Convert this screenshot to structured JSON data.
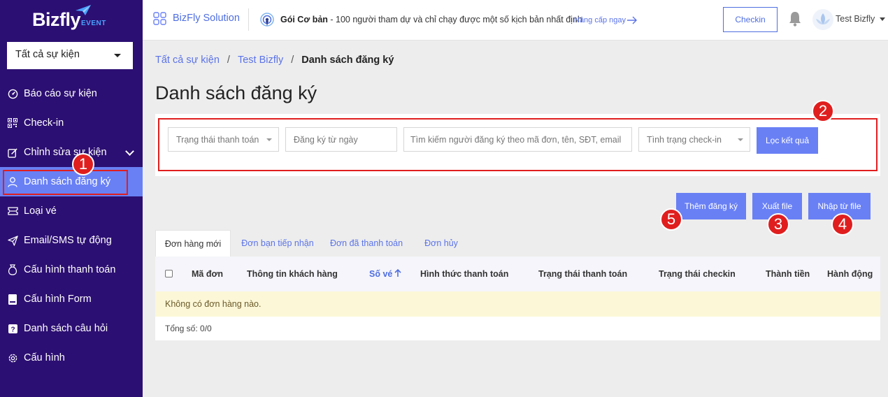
{
  "sidebar": {
    "logo_text": "Bizfly",
    "logo_sub": "EVENT",
    "event_select": "Tất cả sự kiện",
    "items": [
      {
        "label": "Báo cáo sự kiện",
        "icon": "gauge-icon"
      },
      {
        "label": "Check-in",
        "icon": "qrcode-icon"
      },
      {
        "label": "Chỉnh sửa sự kiện",
        "icon": "edit-icon"
      },
      {
        "label": "Danh sách đăng ký",
        "icon": "user-icon"
      },
      {
        "label": "Loại vé",
        "icon": "ticket-icon"
      },
      {
        "label": "Email/SMS tự động",
        "icon": "send-icon"
      },
      {
        "label": "Cấu hình thanh toán",
        "icon": "money-bag-icon"
      },
      {
        "label": "Cấu hình Form",
        "icon": "form-icon"
      },
      {
        "label": "Danh sách câu hỏi",
        "icon": "question-icon"
      },
      {
        "label": "Cấu hình",
        "icon": "gear-icon"
      }
    ]
  },
  "topbar": {
    "brand": "BizFly Solution",
    "plan_name": "Gói Cơ bản",
    "plan_desc": " - 100 người tham dự và chỉ chạy được một số kịch bản nhất định",
    "upgrade": "Nâng cấp ngay",
    "checkin": "Checkin",
    "user": "Test Bizfly"
  },
  "breadcrumb": {
    "item1": "Tất cả sự kiện",
    "item2": "Test Bizfly",
    "current": "Danh sách đăng ký",
    "sep": "/"
  },
  "page_title": "Danh sách đăng ký",
  "filters": {
    "payment_status": "Trạng thái thanh toán",
    "date_from": "Đăng ký từ ngày",
    "search": "Tìm kiếm người đăng ký theo mã đơn, tên, SĐT, email",
    "checkin_status": "Tình trạng check-in",
    "filter_button": "Lọc kết quả"
  },
  "actions": {
    "add": "Thêm đăng ký",
    "export": "Xuất file",
    "import": "Nhập từ file"
  },
  "tabs": [
    "Đơn hàng mới",
    "Đơn bạn tiếp nhận",
    "Đơn đã thanh toán",
    "Đơn hủy"
  ],
  "table": {
    "columns": [
      "Mã đơn",
      "Thông tin khách hàng",
      "Số vé",
      "Hình thức thanh toán",
      "Trạng thái thanh toán",
      "Trạng thái checkin",
      "Thành tiền",
      "Hành động"
    ],
    "empty": "Không có đơn hàng nào.",
    "total": "Tổng số: 0/0"
  },
  "markers": [
    "1",
    "2",
    "3",
    "4",
    "5"
  ],
  "colors": {
    "sidebar_bg": "#2c0f72",
    "accent": "#6980f5",
    "link": "#5b73e8",
    "annotation_red": "#e01e1e",
    "empty_row_bg": "#fcf7d7"
  }
}
